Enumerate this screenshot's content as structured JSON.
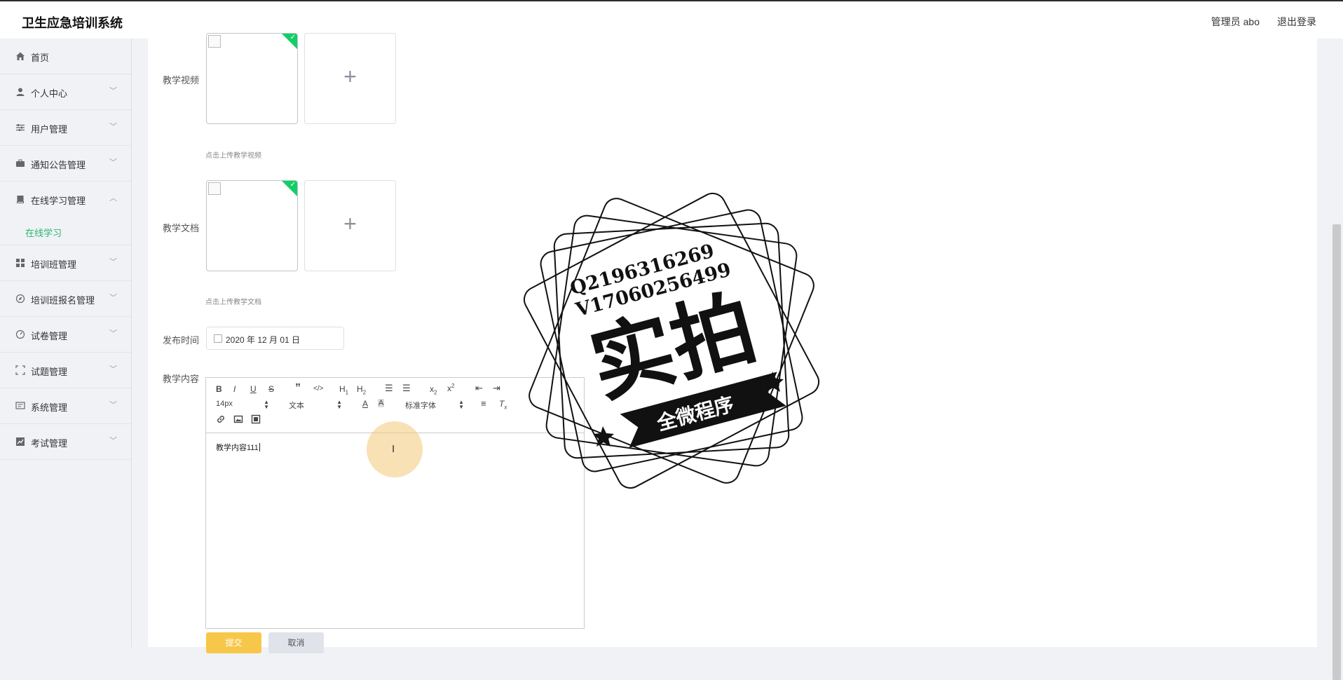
{
  "header": {
    "app_title": "卫生应急培训系统",
    "user_label": "管理员 abo",
    "logout_label": "退出登录"
  },
  "sidebar": {
    "items": [
      {
        "label": "首页",
        "icon": "home-icon"
      },
      {
        "label": "个人中心",
        "icon": "user-icon"
      },
      {
        "label": "用户管理",
        "icon": "sliders-icon"
      },
      {
        "label": "通知公告管理",
        "icon": "briefcase-icon"
      },
      {
        "label": "在线学习管理",
        "icon": "book-icon",
        "expanded": true
      },
      {
        "label": "培训班管理",
        "icon": "grid-icon"
      },
      {
        "label": "培训班报名管理",
        "icon": "compass-icon"
      },
      {
        "label": "试卷管理",
        "icon": "gauge-icon"
      },
      {
        "label": "试题管理",
        "icon": "scan-icon"
      },
      {
        "label": "系统管理",
        "icon": "monitor-icon"
      },
      {
        "label": "考试管理",
        "icon": "chart-icon"
      }
    ],
    "active_subitem": "在线学习",
    "active_color": "#2bb673"
  },
  "form": {
    "video_label": "教学视频",
    "video_hint": "点击上传教学视频",
    "doc_label": "教学文档",
    "doc_hint": "点击上传教学文档",
    "date_label": "发布时间",
    "date_value": "2020 年 12 月 01 日",
    "content_label": "教学内容",
    "editor": {
      "font_size": "14px",
      "block_type": "文本",
      "font_family": "标准字体",
      "body_text": "教学内容111"
    },
    "submit_label": "提交",
    "cancel_label": "取消",
    "success_color": "#13ce66",
    "submit_color": "#f7c74a"
  },
  "watermark": {
    "line1": "Q2196316269",
    "line2": "V17060256499",
    "big_text": "实拍",
    "banner_text": "全微程序"
  }
}
